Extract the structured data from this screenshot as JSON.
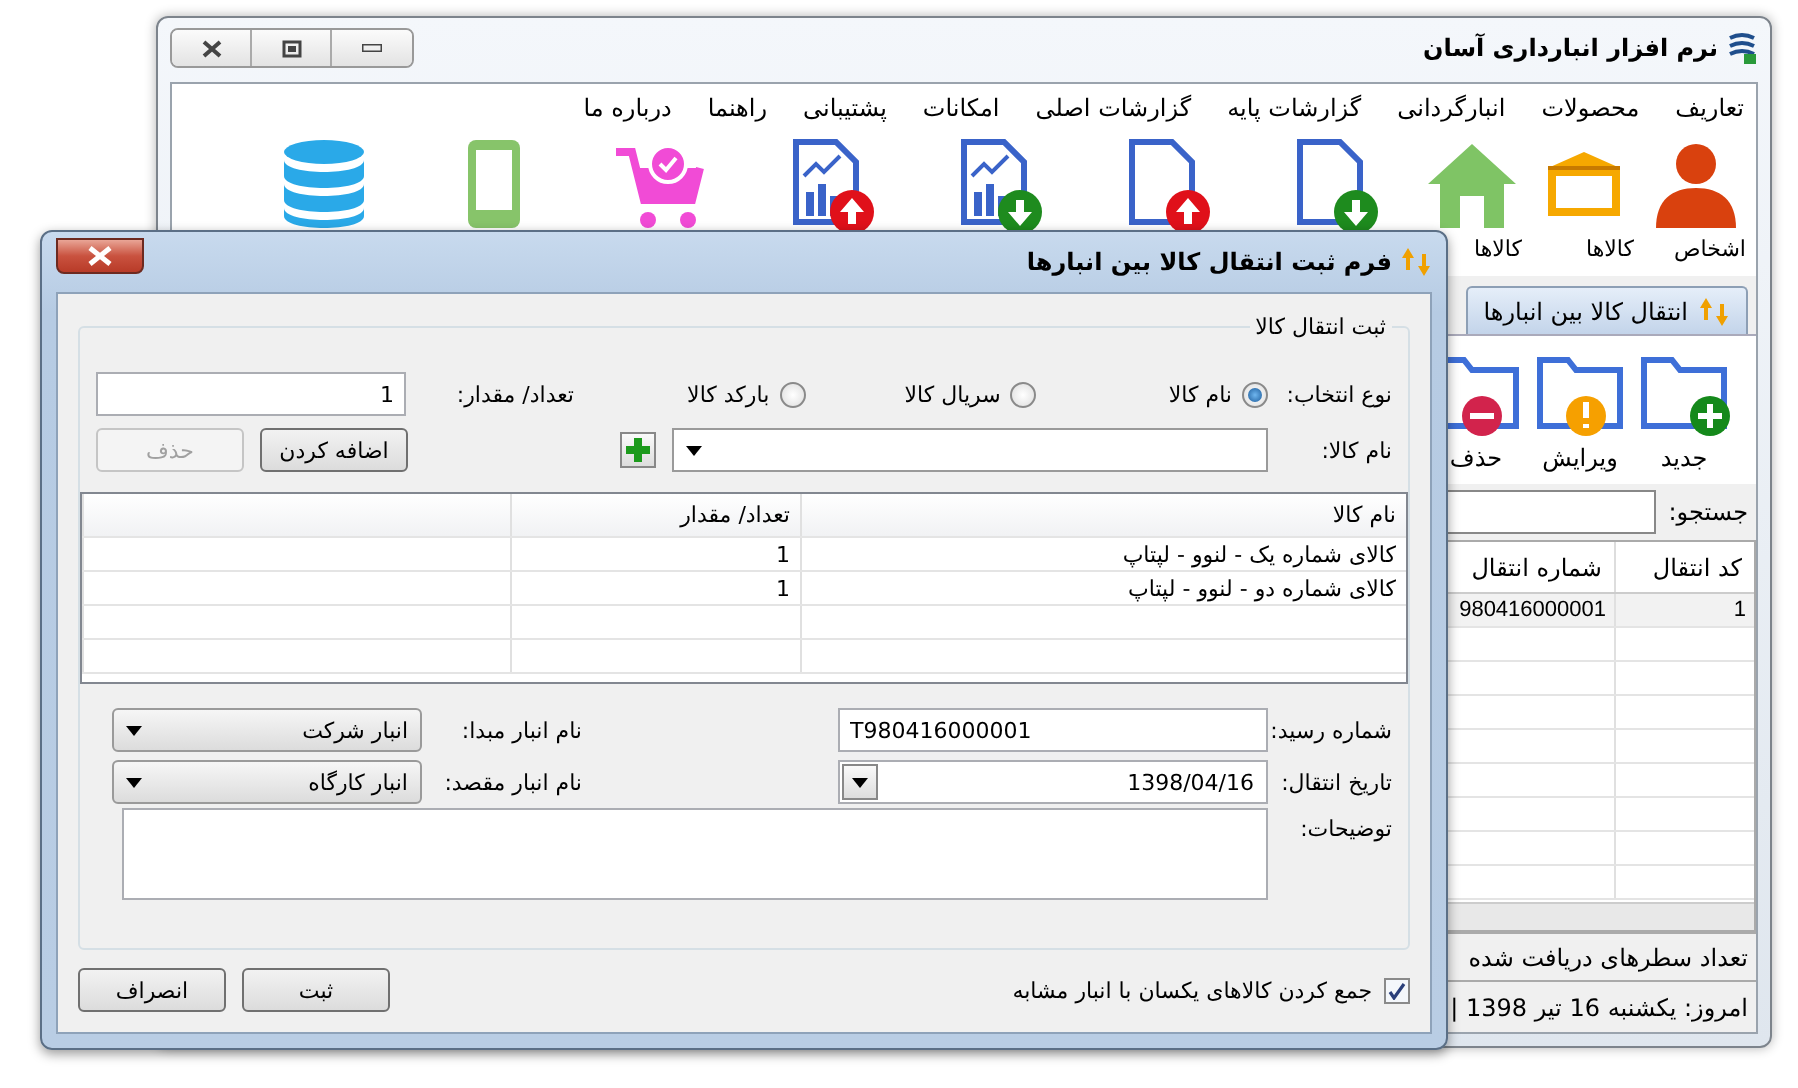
{
  "main_window": {
    "title": "نرم افزار انبارداری آسان",
    "menu": [
      "تعاریف",
      "محصولات",
      "انبارگردانی",
      "گزارشات پایه",
      "گزارشات اصلی",
      "امکانات",
      "پشتیبانی",
      "راهنما",
      "درباره ما"
    ],
    "toolbar": [
      {
        "kind": "person",
        "label": "اشخاص"
      },
      {
        "kind": "box",
        "label": "کالاها"
      },
      {
        "kind": "house",
        "label": "کالاها"
      },
      {
        "kind": "doc-down"
      },
      {
        "kind": "doc-up"
      },
      {
        "kind": "report-down"
      },
      {
        "kind": "report-up"
      },
      {
        "kind": "cart"
      },
      {
        "kind": "phone"
      },
      {
        "kind": "database"
      }
    ],
    "tab": {
      "label": "انتقال کالا بین انبارها",
      "selected": true
    },
    "actions": [
      {
        "kind": "new",
        "label": "جدید"
      },
      {
        "kind": "edit",
        "label": "ویرایش"
      },
      {
        "kind": "delete",
        "label": "حذف"
      }
    ],
    "search_label": "جستجو:",
    "grid": {
      "columns": [
        "کد انتقال",
        "شماره انتقال"
      ],
      "rows": [
        [
          "1",
          "980416000001"
        ]
      ]
    },
    "row_count_label": "تعداد سطرهای دریافت شده",
    "status": "امروز: یکشنبه 16 تیر 1398 |"
  },
  "dialog": {
    "title": "فرم ثبت انتقال کالا بین انبارها",
    "group_title": "ثبت انتقال کالا",
    "selection_label": "نوع انتخاب:",
    "options": [
      {
        "label": "نام کالا",
        "selected": true
      },
      {
        "label": "سریال کالا",
        "selected": false
      },
      {
        "label": "بارکد کالا",
        "selected": false
      }
    ],
    "quantity_label": "تعداد/ مقدار:",
    "quantity_value": "1",
    "product_label": "نام کالا:",
    "add_button": {
      "label": "اضافه کردن",
      "disabled": false
    },
    "delete_button": {
      "label": "حذف",
      "disabled": true
    },
    "table": {
      "columns": [
        "نام کالا",
        "تعداد/ مقدار"
      ],
      "rows": [
        [
          "کالای شماره یک - لنوو - لپتاپ",
          "1"
        ],
        [
          "کالای شماره دو - لنوو - لپتاپ",
          "1"
        ]
      ]
    },
    "receipt_label": "شماره رسید:",
    "receipt_value": "T980416000001",
    "source_label": "نام انبار مبدا:",
    "source_value": "انبار شرکت",
    "date_label": "تاریخ انتقال:",
    "date_value": "1398/04/16",
    "dest_label": "نام انبار مقصد:",
    "dest_value": "انبار کارگاه",
    "notes_label": "توضیحات:",
    "merge_label": "جمع کردن کالاهای یکسان با انبار مشابه",
    "merge_checked": true,
    "buttons": [
      "ثبت",
      "انصراف"
    ]
  }
}
